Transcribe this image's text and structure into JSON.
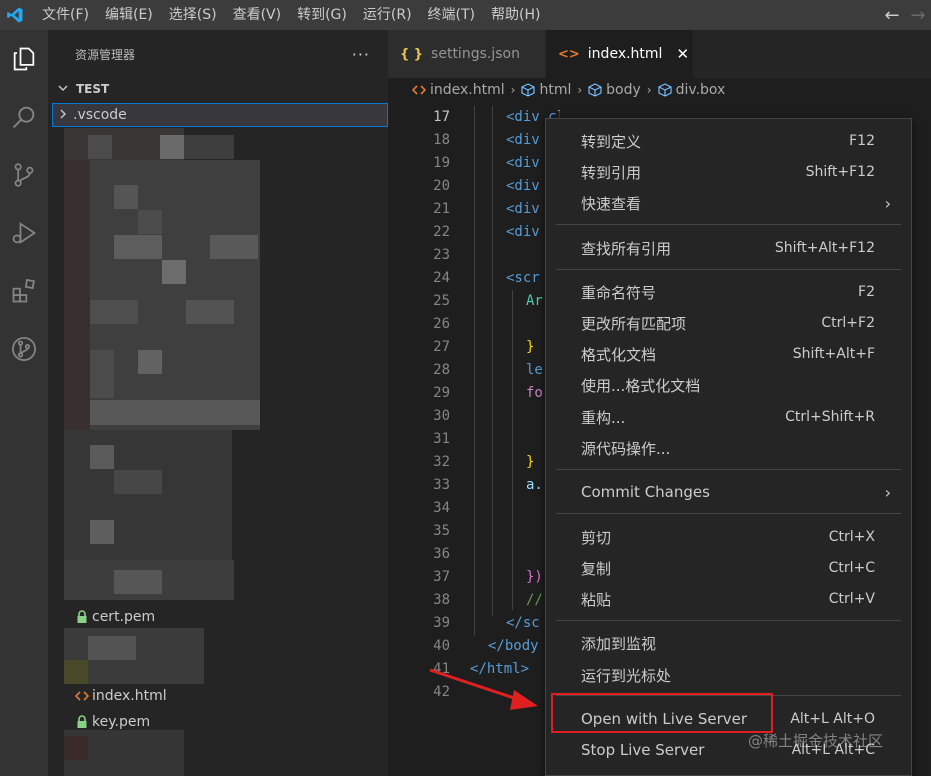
{
  "menubar": {
    "items": [
      "文件(F)",
      "编辑(E)",
      "选择(S)",
      "查看(V)",
      "转到(G)",
      "运行(R)",
      "终端(T)",
      "帮助(H)"
    ],
    "back_arrow": "←",
    "forward_arrow": "→"
  },
  "sidebar": {
    "title": "资源管理器",
    "more": "···",
    "section": "TEST",
    "files": {
      "vscode": ".vscode",
      "cert": "cert.pem",
      "index": "index.html",
      "key": "key.pem"
    }
  },
  "tabs": [
    {
      "icon": "{ }",
      "label": "settings.json"
    },
    {
      "icon": "<>",
      "label": "index.html",
      "close": "✕"
    }
  ],
  "breadcrumb": [
    "index.html",
    "html",
    "body",
    "div.box"
  ],
  "gutter": [
    "17",
    "18",
    "19",
    "20",
    "21",
    "22",
    "23",
    "24",
    "25",
    "26",
    "27",
    "28",
    "29",
    "30",
    "31",
    "32",
    "33",
    "34",
    "35",
    "36",
    "37",
    "38",
    "39",
    "40",
    "41",
    "42"
  ],
  "code": {
    "l17": "<div class=\"box\"></div>",
    "l18": "<div",
    "l19": "<div",
    "l20": "<div",
    "l21": "<div",
    "l22": "<div",
    "l24": "<scr",
    "l25": "Ar",
    "l27": "}",
    "l28": "le",
    "l29": "fo",
    "l32": "}",
    "l33": "a.",
    "l37": "})",
    "l38": "//",
    "l39": "</sc",
    "l40": "</body",
    "l41": "</html>"
  },
  "context_menu": {
    "goto_def": {
      "label": "转到定义",
      "kb": "F12"
    },
    "goto_ref": {
      "label": "转到引用",
      "kb": "Shift+F12"
    },
    "peek": {
      "label": "快速查看",
      "sub": "›"
    },
    "find_all_refs": {
      "label": "查找所有引用",
      "kb": "Shift+Alt+F12"
    },
    "rename": {
      "label": "重命名符号",
      "kb": "F2"
    },
    "change_all": {
      "label": "更改所有匹配项",
      "kb": "Ctrl+F2"
    },
    "format_doc": {
      "label": "格式化文档",
      "kb": "Shift+Alt+F"
    },
    "format_with": {
      "label": "使用...格式化文档"
    },
    "refactor": {
      "label": "重构...",
      "kb": "Ctrl+Shift+R"
    },
    "source_action": {
      "label": "源代码操作..."
    },
    "commit": {
      "label": "Commit Changes",
      "sub": "›"
    },
    "cut": {
      "label": "剪切",
      "kb": "Ctrl+X"
    },
    "copy": {
      "label": "复制",
      "kb": "Ctrl+C"
    },
    "paste": {
      "label": "粘贴",
      "kb": "Ctrl+V"
    },
    "add_watch": {
      "label": "添加到监视"
    },
    "run_to_cursor": {
      "label": "运行到光标处"
    },
    "open_live": {
      "label": "Open with Live Server",
      "kb": "Alt+L Alt+O"
    },
    "stop_live": {
      "label": "Stop Live Server",
      "kb": "Alt+L Alt+C"
    }
  },
  "watermark": "@稀土掘金技术社区",
  "colors": {
    "accent": "#0078d4",
    "vscode_blue": "#23a9f2",
    "highlight": "#e02020",
    "tag": "#569cd6",
    "attr": "#9cdcfe",
    "string": "#ce9178",
    "lock": "#89d185",
    "html_icon": "#e37933"
  }
}
